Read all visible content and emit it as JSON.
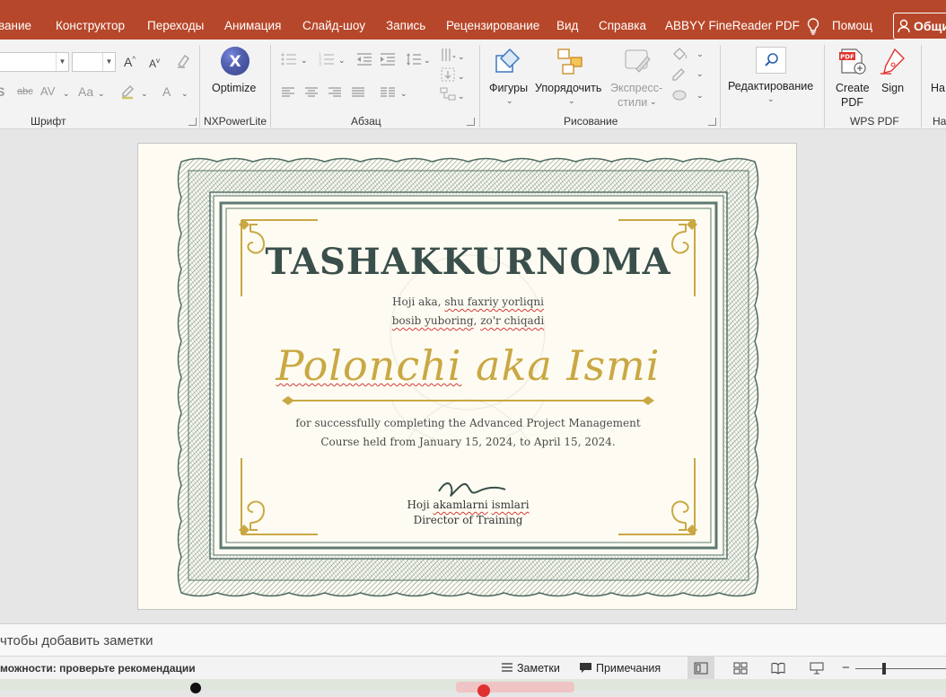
{
  "menu": {
    "tabs": [
      "вание",
      "Конструктор",
      "Переходы",
      "Анимация",
      "Слайд-шоу",
      "Запись",
      "Рецензирование",
      "Вид",
      "Справка",
      "ABBYY FineReader PDF"
    ],
    "tell_me": "Помощ",
    "share": "Общи"
  },
  "ribbon": {
    "groups": {
      "font": "Шрифт",
      "nxpowerlite": "NXPowerLite",
      "paragraph": "Абзац",
      "drawing": "Рисование",
      "wps_pdf": "WPS PDF",
      "cut_group": "На"
    },
    "buttons": {
      "optimize": "Optimize",
      "shapes": "Фигуры",
      "arrange": "Упорядочить",
      "quick_styles_1": "Экспресс-",
      "quick_styles_2": "стили",
      "editing": "Редактирование",
      "create_pdf_1": "Create",
      "create_pdf_2": "PDF",
      "sign": "Sign",
      "cut_button": "На"
    },
    "font_controls": {
      "grow": "A",
      "shrink": "A",
      "strike": "abc",
      "spacing": "AV",
      "case": "Aa",
      "color": "A"
    }
  },
  "certificate": {
    "title": "TASHAKKURNOMA",
    "subtitle_line1_a": "Hoji aka, ",
    "subtitle_line1_b": "shu faxriy yorliqni",
    "subtitle_line2_a": "bosib yuboring",
    "subtitle_line2_b": ", ",
    "subtitle_line2_c": "zo'r chiqadi",
    "recipient_a": "Polonchi",
    "recipient_b": " aka Ismi",
    "body_line1": "for successfully completing the Advanced Project Management",
    "body_line2": "Course held from January 15, 2024, to April 15, 2024.",
    "signer_a": "Hoji ",
    "signer_b": "akamlarni",
    "signer_c": " ",
    "signer_d": "ismlari",
    "signer_title": "Director of Training",
    "colors": {
      "title": "#3a4f4c",
      "gold": "#c9a844",
      "frame": "#5d7a73"
    }
  },
  "notes": {
    "placeholder": "чтобы добавить заметки"
  },
  "status": {
    "accessibility": "можности: проверьте рекомендации",
    "notes_btn": "Заметки",
    "comments_btn": "Примечания",
    "zoom_minus": "−"
  }
}
